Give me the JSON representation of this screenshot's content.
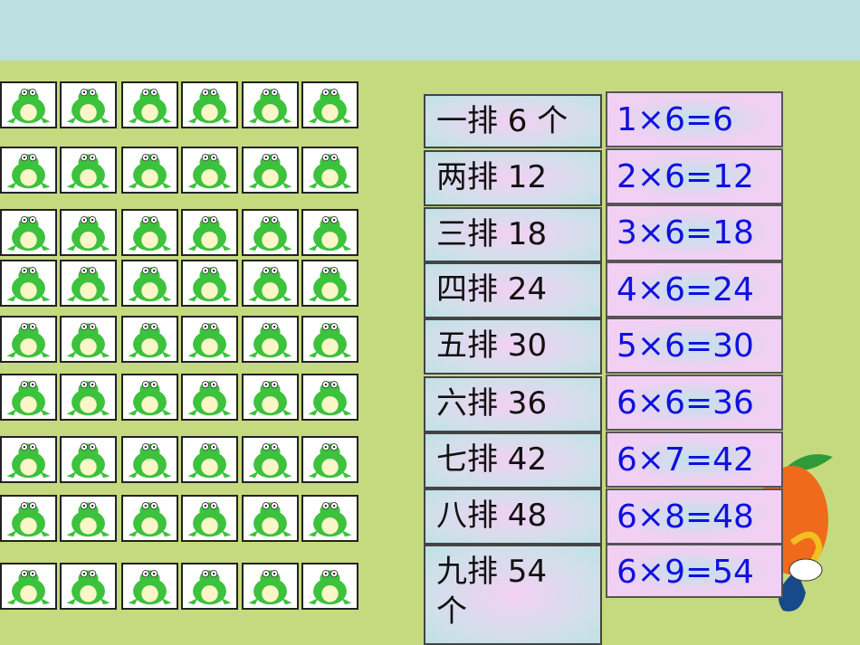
{
  "frog_grid": {
    "rows": 9,
    "per_row": 6
  },
  "rows_text": [
    "一排 6 个",
    "两排 12",
    "三排 18",
    "四排 24",
    "五排 30",
    "六排 36",
    "七排 42",
    "八排 48",
    "九排 54 个"
  ],
  "equations": [
    "1×6=6",
    "2×6=12",
    "3×6=18",
    "4×6=24",
    "5×6=30",
    "6×6=36",
    "6×7=42",
    "6×8=48",
    "6×9=54"
  ],
  "colors": {
    "background": "#c5da7e",
    "top_band": "#bcdfe1",
    "equation_text": "#1010e0",
    "frog": "#3cc23c"
  }
}
